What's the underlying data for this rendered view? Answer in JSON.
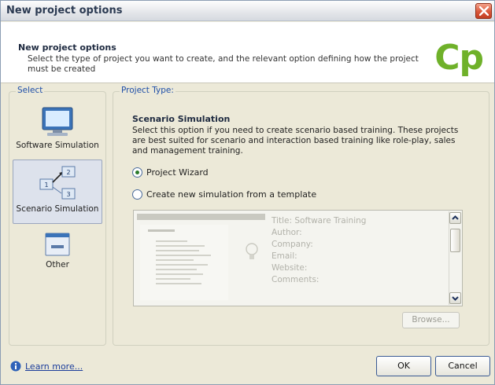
{
  "window": {
    "title": "New project options"
  },
  "header": {
    "title": "New project options",
    "description": "Select the type of project you want to create, and the relevant option defining how the project must be created",
    "logo_text": "Cp",
    "logo_color": "#6fb12a"
  },
  "select": {
    "label": "Select",
    "items": [
      {
        "label": "Software Simulation",
        "icon": "monitor-icon",
        "selected": false
      },
      {
        "label": "Scenario Simulation",
        "icon": "scenario-flow-icon",
        "selected": true
      },
      {
        "label": "Other",
        "icon": "window-icon",
        "selected": false
      }
    ]
  },
  "project_type": {
    "label": "Project Type:",
    "title": "Scenario Simulation",
    "description": "Select this option if you need to create scenario based training. These projects are best suited for scenario and interaction based training like role-play, sales and management training.",
    "options": [
      {
        "label": "Project Wizard",
        "checked": true
      },
      {
        "label": "Create new simulation from a template",
        "checked": false
      }
    ],
    "template": {
      "title": "Title: Software Training",
      "author": "Author:",
      "company": "Company:",
      "email": "Email:",
      "website": "Website:",
      "comments": "Comments:"
    },
    "browse_label": "Browse..."
  },
  "footer": {
    "learn_more": "Learn more...",
    "ok_label": "OK",
    "cancel_label": "Cancel"
  }
}
